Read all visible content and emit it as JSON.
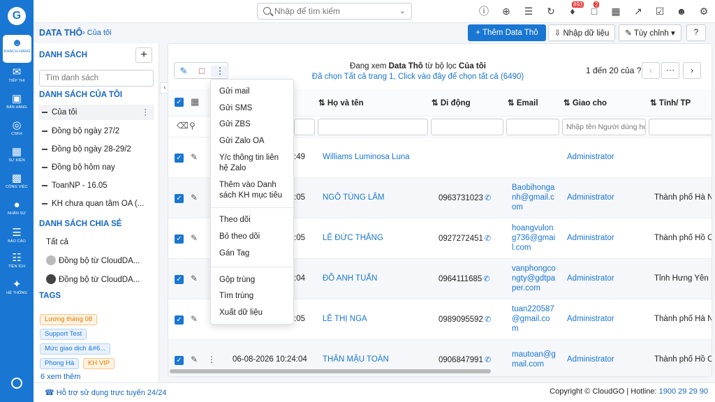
{
  "nav": {
    "items": [
      {
        "label": "KHÁCH HÀNG",
        "icon": "users-icon"
      },
      {
        "label": "TIẾP THỊ",
        "icon": "megaphone-icon"
      },
      {
        "label": "BÁN HÀNG",
        "icon": "cart-icon"
      },
      {
        "label": "CSKH",
        "icon": "support-icon"
      },
      {
        "label": "SỰ KIỆN",
        "icon": "calendar-icon"
      },
      {
        "label": "CÔNG VIỆC",
        "icon": "briefcase-icon"
      },
      {
        "label": "NHÂN SỰ",
        "icon": "person-icon"
      },
      {
        "label": "BÁO CÁO",
        "icon": "chart-icon"
      },
      {
        "label": "TIỆN ÍCH",
        "icon": "apps-icon"
      },
      {
        "label": "HỆ THỐNG",
        "icon": "wrench-icon"
      }
    ]
  },
  "topbar": {
    "search_placeholder": "Nhập để tìm kiếm",
    "bell_badge": "893",
    "chat_badge": "2"
  },
  "header": {
    "title": "DATA THÔ",
    "crumb": "Của tôi",
    "add_button": "+ Thêm Data Thô",
    "import_button": "Nhập dữ liệu",
    "custom_button": "Tùy chỉnh"
  },
  "sidebar": {
    "heading": "DANH SÁCH",
    "search_placeholder": "Tìm danh sách",
    "my_lists_heading": "DANH SÁCH CỦA TÔI",
    "my_lists": [
      "Của tôi",
      "Đồng bộ ngày 27/2",
      "Đồng bộ ngày 28-29/2",
      "Đồng bộ hôm nay",
      "ToanNP - 16.05",
      "KH chưa quan tâm OA (..."
    ],
    "shared_heading": "DANH SÁCH CHIA SẺ",
    "shared": [
      "Tất cả",
      "Đồng bộ từ CloudDA...",
      "Đồng bộ từ CloudDA..."
    ],
    "tags_heading": "TAGS",
    "tags": [
      "Lương tháng 08",
      "Support Test",
      "Mức giao dịch &#6...",
      "Phong Hà",
      "KH VIP"
    ],
    "more_tags": "6 xem thêm"
  },
  "main": {
    "info_prefix": "Đang xem ",
    "info_module": "Data Thô",
    "info_mid": " từ bộ lọc ",
    "info_filter": "Của tôi",
    "select_all": "Đã chọn Tất cả trang 1, Click vào đây để chọn tất cả (6490)",
    "pager": "1 đến 20 của",
    "columns": [
      "Họ và tên",
      "Di động",
      "Email",
      "Giao cho",
      "Tỉnh/ TP"
    ],
    "owner_placeholder": "Nhập tên Người dùng hoặc Nhóm",
    "rows": [
      {
        "time": ":49",
        "name": "Williams Luminosa Luna",
        "phone": "",
        "email": "",
        "owner": "Administrator",
        "city": ""
      },
      {
        "time": ":05",
        "name": "NGÔ TÙNG LÂM",
        "phone": "0963731023",
        "email": "Baobihonganh@gmail.com",
        "owner": "Administrator",
        "city": "Thành phố Hà Nội"
      },
      {
        "time": ":05",
        "name": "LÊ ĐỨC THẮNG",
        "phone": "0927272451",
        "email": "hoangvulong736@gmail.com",
        "owner": "Administrator",
        "city": "Thành phố Hồ Chí Minh"
      },
      {
        "time": ":04",
        "name": "ĐỖ ANH TUẤN",
        "phone": "0964111685",
        "email": "vanphongcongty@gdtpaper.com",
        "owner": "Administrator",
        "city": "Tỉnh Hưng Yên"
      },
      {
        "time": ":05",
        "name": "LÊ THỊ NGA",
        "phone": "0989095592",
        "email": "tuan220587@gmail.com",
        "owner": "Administrator",
        "city": "Thành phố Hà Nội"
      },
      {
        "time": "06-08-2026 10:24:04",
        "name": "THÂN MẬU TOÀN",
        "phone": "0906847991",
        "email": "mautoan@gmail.com",
        "owner": "Administrator",
        "city": "Thành phố Hồ Chí Minh"
      }
    ]
  },
  "menu": {
    "group1": [
      "Gửi mail",
      "Gửi SMS",
      "Gửi ZBS",
      "Gửi Zalo OA",
      "Y/c thông tin liên hệ Zalo",
      "Thêm vào Danh sách KH mục tiêu"
    ],
    "group2": [
      "Theo dõi",
      "Bỏ theo dõi",
      "Gán Tag"
    ],
    "group3": [
      "Gộp trùng",
      "Tìm trùng",
      "Xuất dữ liệu"
    ]
  },
  "footer": {
    "support": "Hỗ trợ sử dụng trực tuyến 24/24",
    "copyright": "Copyright © CloudGO | Hotline: ",
    "hotline": "1900 29 29 90"
  },
  "colors": {
    "primary": "#1976d2",
    "link": "#1565c0",
    "badge": "#e53935"
  }
}
